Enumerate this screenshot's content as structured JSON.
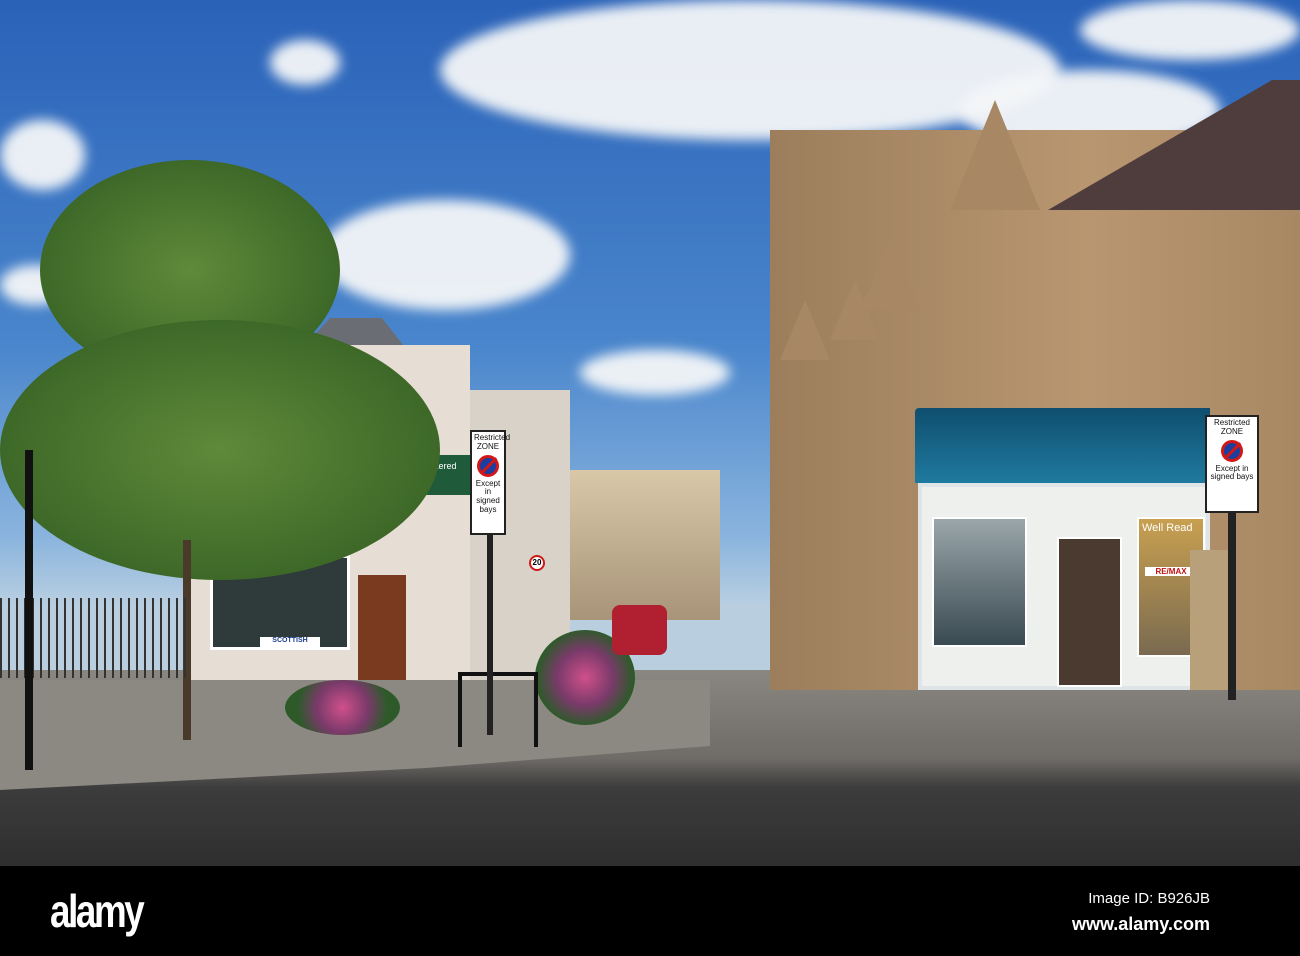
{
  "photo": {
    "signs": {
      "restricted_zone_title": "Restricted ZONE",
      "restricted_zone_note": "Except in signed bays",
      "estate_agent": "Estate Agents Chartered Surveyor",
      "building_society": "SCOTTISH",
      "bookshop": "Well Read",
      "remax": "RE/MAX",
      "speed_limit": "20"
    }
  },
  "watermark": {
    "logo": "alamy",
    "image_id": "Image ID: B926JB",
    "url": "www.alamy.com"
  }
}
